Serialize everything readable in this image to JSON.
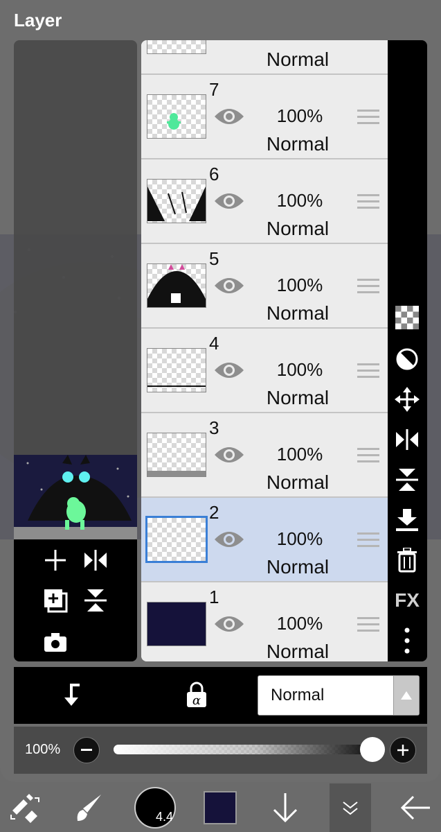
{
  "panel": {
    "title": "Layer"
  },
  "layers": [
    {
      "number": "",
      "opacity": "",
      "blend": "Normal",
      "thumb": "partial"
    },
    {
      "number": "7",
      "opacity": "100%",
      "blend": "Normal",
      "thumb": "green-figure"
    },
    {
      "number": "6",
      "opacity": "100%",
      "blend": "Normal",
      "thumb": "lineart"
    },
    {
      "number": "5",
      "opacity": "100%",
      "blend": "Normal",
      "thumb": "black-creature"
    },
    {
      "number": "4",
      "opacity": "100%",
      "blend": "Normal",
      "thumb": "ground-line"
    },
    {
      "number": "3",
      "opacity": "100%",
      "blend": "Normal",
      "thumb": "ground-fill"
    },
    {
      "number": "2",
      "opacity": "100%",
      "blend": "Normal",
      "thumb": "empty",
      "selected": true
    },
    {
      "number": "1",
      "opacity": "100%",
      "blend": "Normal",
      "thumb": "navy-fill"
    }
  ],
  "right_toolbar": {
    "fx_label": "FX"
  },
  "blend_bar": {
    "mode": "Normal"
  },
  "opacity_bar": {
    "label": "100%",
    "value": 1.0
  },
  "brush": {
    "size": "4.4"
  },
  "colors": {
    "primary": "#15123a",
    "selected_row": "#cdd9ee",
    "accent": "#3a7fd6"
  }
}
